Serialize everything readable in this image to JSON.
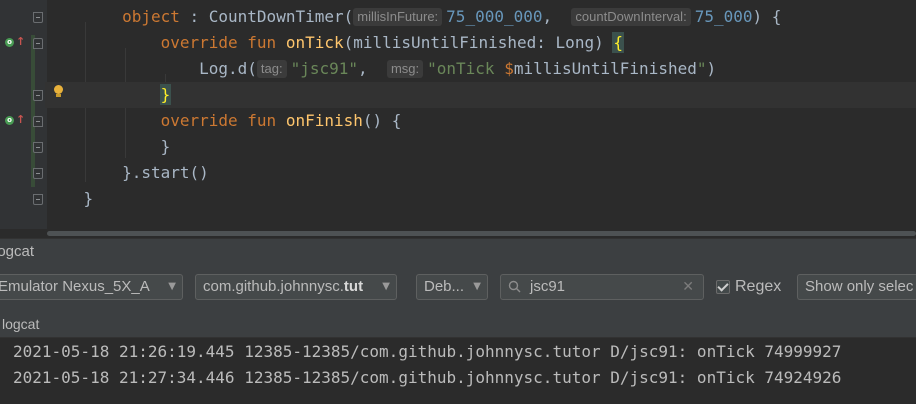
{
  "editor": {
    "lines": [
      {
        "indent": "    ",
        "tokens": [
          {
            "t": "object",
            "c": "kw"
          },
          {
            "t": " : CountDownTimer(",
            "c": "plain"
          },
          {
            "t": "millisInFuture:",
            "c": "hint"
          },
          {
            "t": "75_000_000",
            "c": "num"
          },
          {
            "t": ",  ",
            "c": "plain"
          },
          {
            "t": "countDownInterval:",
            "c": "hint"
          },
          {
            "t": "75_000",
            "c": "num"
          },
          {
            "t": ") {",
            "c": "plain"
          }
        ]
      },
      {
        "indent": "        ",
        "tokens": [
          {
            "t": "override fun ",
            "c": "kw"
          },
          {
            "t": "onTick",
            "c": "fn"
          },
          {
            "t": "(millisUntilFinished: Long) ",
            "c": "plain"
          },
          {
            "t": "{",
            "c": "match"
          }
        ]
      },
      {
        "indent": "            ",
        "tokens": [
          {
            "t": "Log.d(",
            "c": "plain"
          },
          {
            "t": "tag:",
            "c": "hint"
          },
          {
            "t": "\"jsc91\"",
            "c": "str"
          },
          {
            "t": ",  ",
            "c": "plain"
          },
          {
            "t": "msg:",
            "c": "hint"
          },
          {
            "t": "\"onTick ",
            "c": "str"
          },
          {
            "t": "$",
            "c": "tpl"
          },
          {
            "t": "millisUntilFinished",
            "c": "plain"
          },
          {
            "t": "\"",
            "c": "str"
          },
          {
            "t": ")",
            "c": "plain"
          }
        ]
      },
      {
        "indent": "        ",
        "tokens": [
          {
            "t": "}",
            "c": "match"
          }
        ]
      },
      {
        "indent": "        ",
        "tokens": [
          {
            "t": "override fun ",
            "c": "kw"
          },
          {
            "t": "onFinish",
            "c": "fn"
          },
          {
            "t": "() {",
            "c": "plain"
          }
        ]
      },
      {
        "indent": "        ",
        "tokens": [
          {
            "t": "}",
            "c": "plain"
          }
        ]
      },
      {
        "indent": "    ",
        "tokens": [
          {
            "t": "}.start()",
            "c": "plain"
          }
        ]
      },
      {
        "indent": "",
        "tokens": [
          {
            "t": "}",
            "c": "plain"
          }
        ]
      }
    ]
  },
  "logcat": {
    "tool_title": "logcat",
    "device": "Emulator Nexus_5X_A",
    "package_prefix": "com.github.johnnysc.",
    "package_bold": "tut",
    "level": "Deb...",
    "search_value": "jsc91",
    "regex_label": "Regex",
    "regex_checked": true,
    "filter": "Show only selec",
    "subheader": "logcat",
    "entries": [
      "2021-05-18 21:26:19.445 12385-12385/com.github.johnnysc.tutor D/jsc91: onTick 74999927",
      "2021-05-18 21:27:34.446 12385-12385/com.github.johnnysc.tutor D/jsc91: onTick 74924926"
    ]
  },
  "icons": [
    "override-icon",
    "bulb-icon",
    "search-icon",
    "clear-icon",
    "chevron-down-icon"
  ],
  "colors": {
    "keyword": "#cc7832",
    "function": "#ffc66d",
    "number": "#6897bb",
    "string": "#6a8759"
  }
}
